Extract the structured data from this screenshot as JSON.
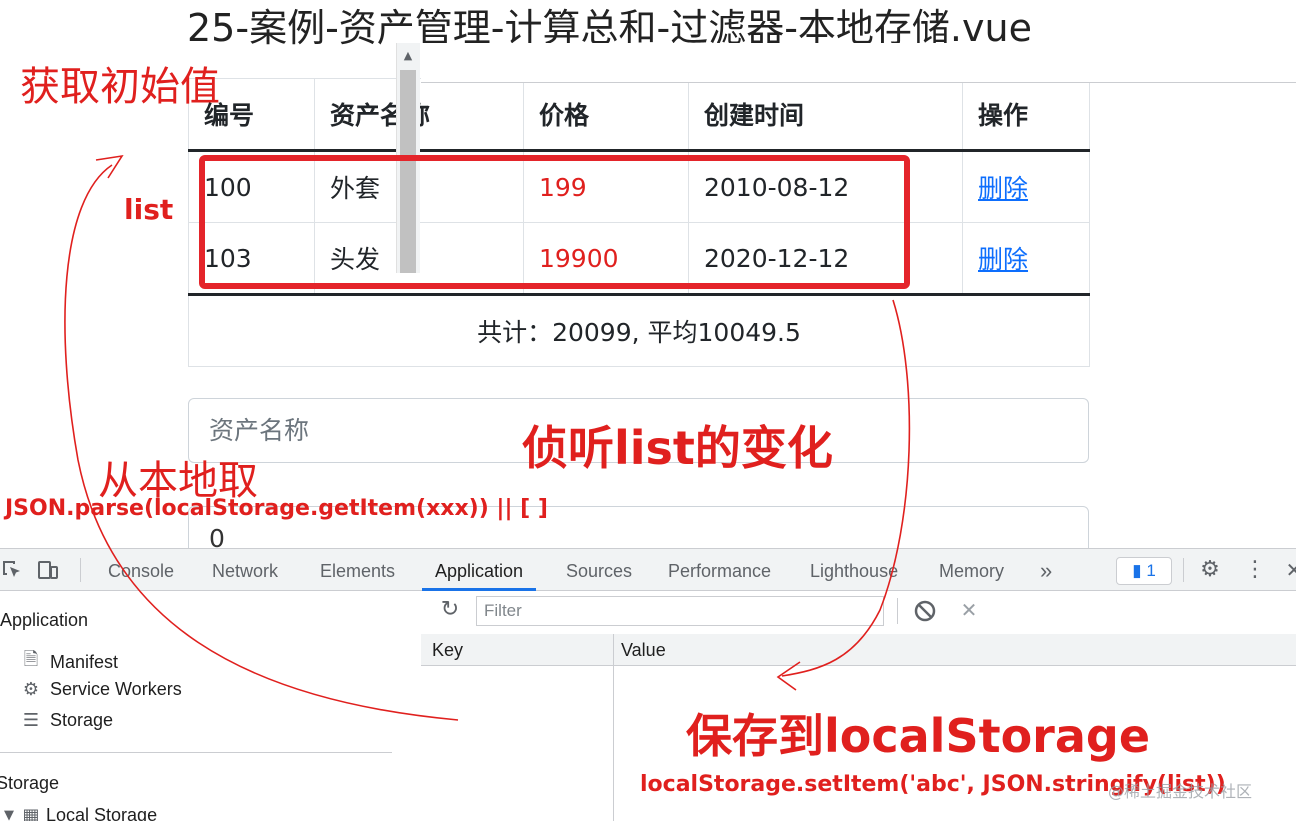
{
  "page": {
    "title": "25-案例-资产管理-计算总和-过滤器-本地存储.vue",
    "table": {
      "headers": [
        "编号",
        "资产名称",
        "价格",
        "创建时间",
        "操作"
      ],
      "rows": [
        {
          "id": "100",
          "name": "外套",
          "price": "199",
          "time": "2010-08-12",
          "action": "删除"
        },
        {
          "id": "103",
          "name": "头发",
          "price": "19900",
          "time": "2020-12-12",
          "action": "删除"
        }
      ],
      "summary": "共计：20099, 平均10049.5"
    },
    "name_input": {
      "placeholder": "资产名称",
      "value": ""
    },
    "price_input": {
      "value": "0"
    }
  },
  "devtools": {
    "tabs": [
      "Console",
      "Network",
      "Elements",
      "Application",
      "Sources",
      "Performance",
      "Lighthouse",
      "Memory"
    ],
    "active_tab": "Application",
    "more_tabs": "»",
    "issues_count": "1",
    "sidebar": {
      "application_header": "Application",
      "items": [
        {
          "label": "Manifest",
          "icon": "file-icon"
        },
        {
          "label": "Service Workers",
          "icon": "gear-icon"
        },
        {
          "label": "Storage",
          "icon": "database-icon"
        }
      ],
      "storage_header": "Storage",
      "local_storage": "Local Storage"
    },
    "toolbar": {
      "filter_placeholder": "Filter"
    },
    "grid": {
      "key_header": "Key",
      "value_header": "Value"
    }
  },
  "annotations": {
    "get_initial": "获取初始值",
    "list_label": "list",
    "watch_list": "侦听list的变化",
    "from_local": "从本地取",
    "parse_code": "JSON.parse(localStorage.getItem(xxx)) || [ ]",
    "save_local": "保存到localStorage",
    "set_code": "localStorage.setItem('abc', JSON.stringify(list))"
  },
  "watermark": "@稀土掘金技术社区",
  "colors": {
    "annotation_red": "#e0201e",
    "link_blue": "#0d6efd",
    "devtools_accent": "#1a73e8"
  }
}
